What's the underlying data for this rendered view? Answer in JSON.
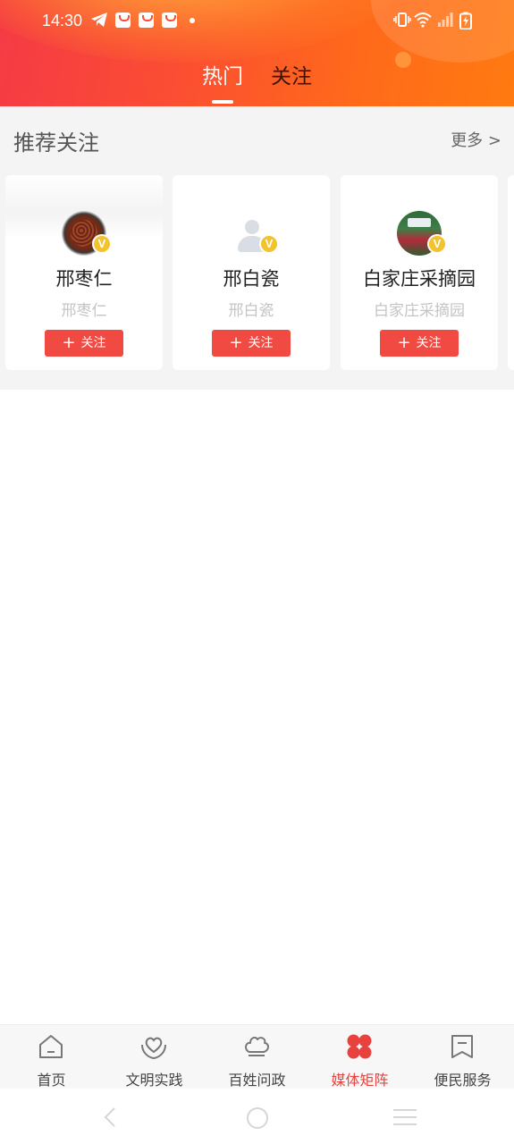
{
  "status_bar": {
    "time": "14:30",
    "icons": [
      "telegram-icon",
      "bag-icon",
      "bag-icon",
      "bag-icon",
      "dot",
      "vibrate-icon",
      "wifi-icon",
      "signal-icon",
      "battery-charging-icon"
    ]
  },
  "header": {
    "tabs": [
      {
        "label": "热门",
        "active": true
      },
      {
        "label": "关注",
        "active": false
      }
    ]
  },
  "recommend": {
    "title": "推荐关注",
    "more_label": "更多 >",
    "cards": [
      {
        "name": "邢枣仁",
        "subtitle": "邢枣仁",
        "avatar": "jujube-avatar",
        "verified_badge": "V",
        "button_label": "关注"
      },
      {
        "name": "邢白瓷",
        "subtitle": "邢白瓷",
        "avatar": "default-user-avatar",
        "verified_badge": "V",
        "button_label": "关注"
      },
      {
        "name": "白家庄采摘园",
        "subtitle": "白家庄采摘园",
        "avatar": "garden-avatar",
        "verified_badge": "V",
        "button_label": "关注"
      }
    ]
  },
  "bottom_nav": {
    "items": [
      {
        "label": "首页",
        "icon": "home-icon",
        "active": false
      },
      {
        "label": "文明实践",
        "icon": "heart-hands-icon",
        "active": false
      },
      {
        "label": "百姓问政",
        "icon": "chef-hat-icon",
        "active": false
      },
      {
        "label": "媒体矩阵",
        "icon": "four-petal-icon",
        "active": true
      },
      {
        "label": "便民服务",
        "icon": "bookmark-icon",
        "active": false
      }
    ]
  },
  "colors": {
    "accent": "#e8423f",
    "header_start": "#f53a45",
    "header_end": "#ff7a10",
    "badge": "#f4c22b"
  },
  "system_nav": {
    "icons": [
      "back-icon",
      "home-circle-icon",
      "menu-icon"
    ]
  }
}
